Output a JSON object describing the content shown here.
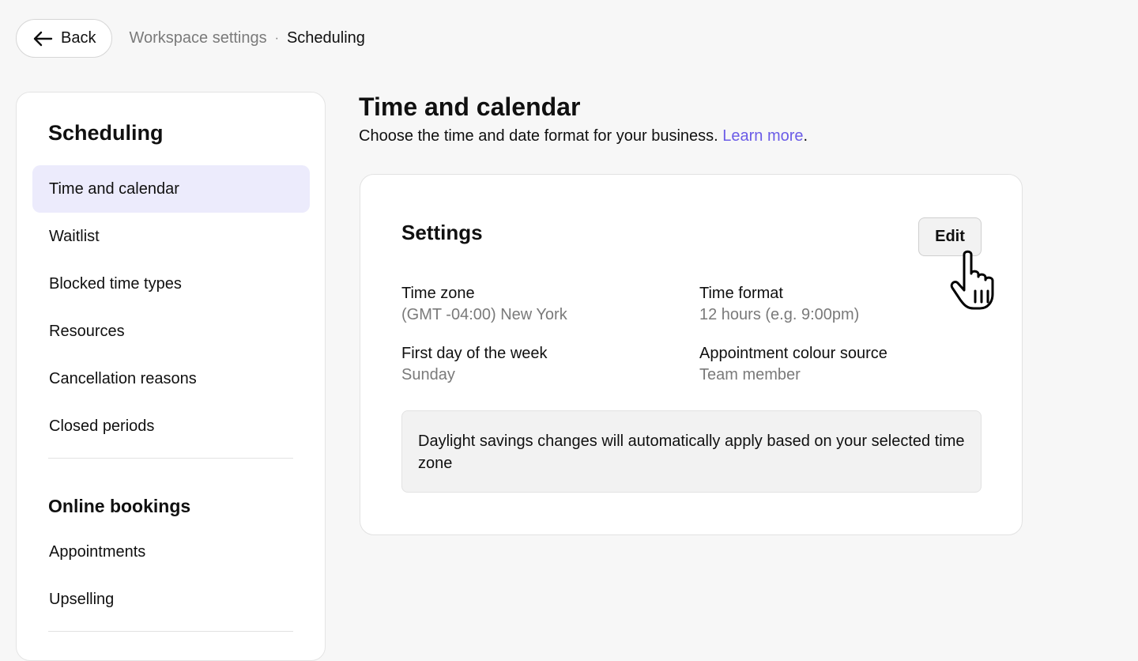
{
  "header": {
    "back_label": "Back",
    "breadcrumb": {
      "parent": "Workspace settings",
      "separator": "·",
      "current": "Scheduling"
    }
  },
  "sidebar": {
    "section1_title": "Scheduling",
    "items": [
      {
        "label": "Time and calendar",
        "active": true
      },
      {
        "label": "Waitlist"
      },
      {
        "label": "Blocked time types"
      },
      {
        "label": "Resources"
      },
      {
        "label": "Cancellation reasons"
      },
      {
        "label": "Closed periods"
      }
    ],
    "section2_title": "Online bookings",
    "items2": [
      {
        "label": "Appointments"
      },
      {
        "label": "Upselling"
      }
    ]
  },
  "main": {
    "title": "Time and calendar",
    "subtitle": "Choose the time and date format for your business.",
    "learn_more": "Learn more",
    "period": "."
  },
  "settings_card": {
    "title": "Settings",
    "edit_label": "Edit",
    "fields": [
      {
        "label": "Time zone",
        "value": "(GMT -04:00) New York"
      },
      {
        "label": "Time format",
        "value": "12 hours (e.g. 9:00pm)"
      },
      {
        "label": "First day of the week",
        "value": "Sunday"
      },
      {
        "label": "Appointment colour source",
        "value": "Team member"
      }
    ],
    "notice": "Daylight savings changes will automatically apply based on your selected time zone"
  },
  "colors": {
    "accent": "#6b5ce7",
    "active_nav_bg": "#ecebfc",
    "page_bg": "#f7f7f7"
  },
  "icons": {
    "back": "arrow-left-icon",
    "cursor": "hand-pointer-icon"
  }
}
